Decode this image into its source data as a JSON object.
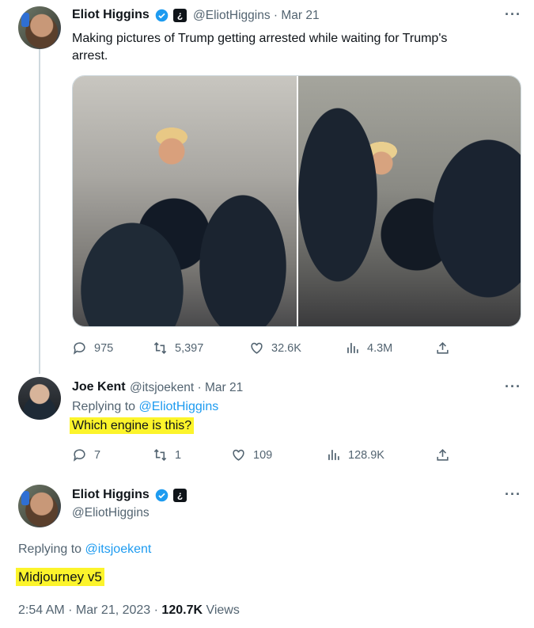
{
  "tweet1": {
    "name": "Eliot Higgins",
    "handle": "@EliotHiggins",
    "date": "Mar 21",
    "text_line1": "Making pictures of Trump getting arrested while waiting for Trump's",
    "text_line2": "arrest.",
    "replies": "975",
    "retweets": "5,397",
    "likes": "32.6K",
    "views": "4.3M"
  },
  "tweet2": {
    "name": "Joe Kent",
    "handle": "@itsjoekent",
    "date": "Mar 21",
    "replying_prefix": "Replying to",
    "replying_handle": "@EliotHiggins",
    "text": "Which engine is this?",
    "replies": "7",
    "retweets": "1",
    "likes": "109",
    "views": "128.9K"
  },
  "tweet3": {
    "name": "Eliot Higgins",
    "handle": "@EliotHiggins",
    "replying_prefix": "Replying to",
    "replying_handle": "@itsjoekent",
    "text": "Midjourney v5",
    "time": "2:54 AM",
    "date": "Mar 21, 2023",
    "views_count": "120.7K",
    "views_label": "Views"
  },
  "icons": {
    "reply": "reply-icon",
    "retweet": "retweet-icon",
    "like": "heart-icon",
    "views": "views-icon",
    "share": "share-icon",
    "verified": "verified-badge-icon",
    "more": "more-options-icon"
  },
  "colors": {
    "accent": "#1d9bf0",
    "highlight": "#fcf42b",
    "muted": "#536471"
  }
}
